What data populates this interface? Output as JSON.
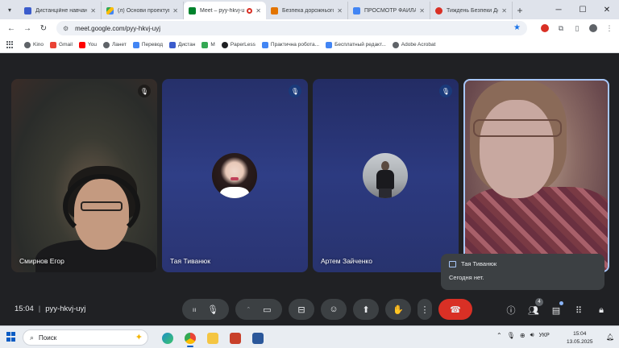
{
  "browser": {
    "tabs": [
      {
        "title": "Дистанційне навчання",
        "favicon_color": "#3b5ccc",
        "active": false
      },
      {
        "title": "(л) Основи проектуван",
        "favicon_color": "#34a853",
        "active": false
      },
      {
        "title": "Meet – pyy-hkvj-uyj",
        "favicon_color": "#00832d",
        "active": true
      },
      {
        "title": "Безпека дорожнього",
        "favicon_color": "#e37400",
        "active": false
      },
      {
        "title": "ПРОСМОТР ФАЙЛА",
        "favicon_color": "#4285f4",
        "active": false
      },
      {
        "title": "Тиждень Безпеки Дор",
        "favicon_color": "#d93025",
        "active": false
      }
    ],
    "address": "meet.google.com/pyy-hkvj-uyj",
    "bookmarks": [
      {
        "label": "Kino",
        "color": "#5f6368"
      },
      {
        "label": "Gmail",
        "color": "#ea4335"
      },
      {
        "label": "You",
        "color": "#ff0000"
      },
      {
        "label": "Ланет",
        "color": "#5f6368"
      },
      {
        "label": "Перевод",
        "color": "#4285f4"
      },
      {
        "label": "Дистан",
        "color": "#3b5ccc"
      },
      {
        "label": "M",
        "color": "#34a853"
      },
      {
        "label": "PaperLess",
        "color": "#202124"
      },
      {
        "label": "Практична робота...",
        "color": "#4285f4"
      },
      {
        "label": "Бесплатный редакт...",
        "color": "#4285f4"
      },
      {
        "label": "Adobe Acrobat",
        "color": "#5f6368"
      }
    ]
  },
  "meet": {
    "participants": [
      {
        "name": "Смирнов Егор"
      },
      {
        "name": "Тая Тиванюк"
      },
      {
        "name": "Артем Зайченко"
      },
      {
        "name": ""
      }
    ],
    "chat_toast": {
      "sender": "Тая Тиванюк",
      "message": "Сегодня нет."
    },
    "time": "15:04",
    "meeting_code": "pyy-hkvj-uyj",
    "people_count": "4"
  },
  "taskbar": {
    "search_label": "Поиск",
    "language": "УКР",
    "time": "15:04",
    "date": "13.05.2025"
  },
  "colors": {
    "accent": "#1a73e8",
    "end_call": "#d93025",
    "meet_bg": "#202124",
    "active_tile_border": "#a8c7fa"
  }
}
